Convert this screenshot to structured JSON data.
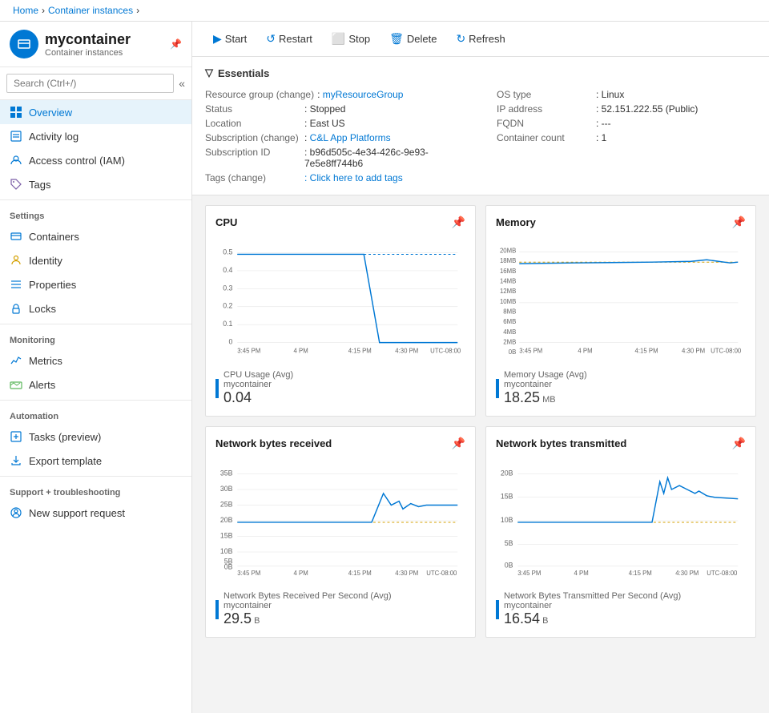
{
  "breadcrumb": {
    "home": "Home",
    "separator1": ">",
    "container_instances": "Container instances",
    "separator2": ">",
    "current": ""
  },
  "sidebar": {
    "title": "mycontainer",
    "subtitle": "Container instances",
    "search_placeholder": "Search (Ctrl+/)",
    "collapse_label": "«",
    "items": [
      {
        "id": "overview",
        "label": "Overview",
        "icon": "grid",
        "active": true,
        "section": null
      },
      {
        "id": "activity-log",
        "label": "Activity log",
        "icon": "list",
        "active": false,
        "section": null
      },
      {
        "id": "access-control",
        "label": "Access control (IAM)",
        "icon": "person",
        "active": false,
        "section": null
      },
      {
        "id": "tags",
        "label": "Tags",
        "icon": "tag",
        "active": false,
        "section": null
      }
    ],
    "sections": [
      {
        "label": "Settings",
        "items": [
          {
            "id": "containers",
            "label": "Containers",
            "icon": "box"
          },
          {
            "id": "identity",
            "label": "Identity",
            "icon": "key"
          },
          {
            "id": "properties",
            "label": "Properties",
            "icon": "bars"
          },
          {
            "id": "locks",
            "label": "Locks",
            "icon": "lock"
          }
        ]
      },
      {
        "label": "Monitoring",
        "items": [
          {
            "id": "metrics",
            "label": "Metrics",
            "icon": "chart"
          },
          {
            "id": "alerts",
            "label": "Alerts",
            "icon": "bell"
          }
        ]
      },
      {
        "label": "Automation",
        "items": [
          {
            "id": "tasks",
            "label": "Tasks (preview)",
            "icon": "tasks"
          },
          {
            "id": "export",
            "label": "Export template",
            "icon": "export"
          }
        ]
      },
      {
        "label": "Support + troubleshooting",
        "items": [
          {
            "id": "support",
            "label": "New support request",
            "icon": "support"
          }
        ]
      }
    ]
  },
  "toolbar": {
    "start_label": "Start",
    "restart_label": "Restart",
    "stop_label": "Stop",
    "delete_label": "Delete",
    "refresh_label": "Refresh"
  },
  "essentials": {
    "title": "Essentials",
    "left": [
      {
        "label": "Resource group (change)",
        "value": "myResourceGroup",
        "link": true
      },
      {
        "label": "Status",
        "value": "Stopped",
        "link": false
      },
      {
        "label": "Location",
        "value": "East US",
        "link": false
      },
      {
        "label": "Subscription (change)",
        "value": "C&L App Platforms",
        "link": true
      },
      {
        "label": "Subscription ID",
        "value": "b96d505c-4e34-426c-9e93-7e5e8ff744b6",
        "link": false
      },
      {
        "label": "Tags (change)",
        "value": "Click here to add tags",
        "link": true
      }
    ],
    "right": [
      {
        "label": "OS type",
        "value": "Linux",
        "link": false
      },
      {
        "label": "IP address",
        "value": "52.151.222.55 (Public)",
        "link": false
      },
      {
        "label": "FQDN",
        "value": "---",
        "link": false
      },
      {
        "label": "Container count",
        "value": "1",
        "link": false
      }
    ]
  },
  "charts": {
    "cpu": {
      "title": "CPU",
      "legend_label": "CPU Usage (Avg)",
      "legend_sublabel": "mycontainer",
      "value": "0.04",
      "unit": "",
      "time_labels": [
        "3:45 PM",
        "4 PM",
        "4:15 PM",
        "4:30 PM",
        "UTC-08:00"
      ],
      "y_labels": [
        "0.5",
        "0.4",
        "0.3",
        "0.2",
        "0.1",
        "0"
      ]
    },
    "memory": {
      "title": "Memory",
      "legend_label": "Memory Usage (Avg)",
      "legend_sublabel": "mycontainer",
      "value": "18.25",
      "unit": "MB",
      "time_labels": [
        "3:45 PM",
        "4 PM",
        "4:15 PM",
        "4:30 PM",
        "UTC-08:00"
      ],
      "y_labels": [
        "20MB",
        "18MB",
        "16MB",
        "14MB",
        "12MB",
        "10MB",
        "8MB",
        "6MB",
        "4MB",
        "2MB",
        "0B"
      ]
    },
    "network_received": {
      "title": "Network bytes received",
      "legend_label": "Network Bytes Received Per Second (Avg)",
      "legend_sublabel": "mycontainer",
      "value": "29.5",
      "unit": "B",
      "time_labels": [
        "3:45 PM",
        "4 PM",
        "4:15 PM",
        "4:30 PM",
        "UTC-08:00"
      ],
      "y_labels": [
        "35B",
        "30B",
        "25B",
        "20B",
        "15B",
        "10B",
        "5B",
        "0B"
      ]
    },
    "network_transmitted": {
      "title": "Network bytes transmitted",
      "legend_label": "Network Bytes Transmitted Per Second (Avg)",
      "legend_sublabel": "mycontainer",
      "value": "16.54",
      "unit": "B",
      "time_labels": [
        "3:45 PM",
        "4 PM",
        "4:15 PM",
        "4:30 PM",
        "UTC-08:00"
      ],
      "y_labels": [
        "20B",
        "15B",
        "10B",
        "5B",
        "0B"
      ]
    }
  }
}
